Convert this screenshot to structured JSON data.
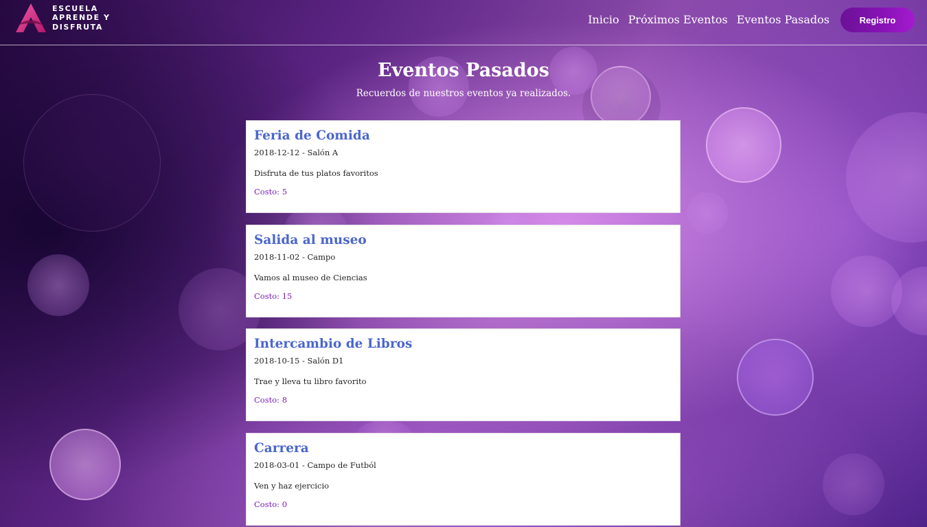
{
  "brand": {
    "logo_lines": [
      "ESCUELA",
      "APRENDE Y",
      "DISFRUTA"
    ]
  },
  "nav": {
    "items": [
      {
        "label": "Inicio"
      },
      {
        "label": "Próximos Eventos"
      },
      {
        "label": "Eventos Pasados"
      }
    ],
    "register_label": "Registro"
  },
  "page": {
    "title": "Eventos Pasados",
    "subtitle": "Recuerdos de nuestros eventos ya realizados."
  },
  "events": [
    {
      "title": "Feria de Comida",
      "date": "2018-12-12",
      "place": "Salón A",
      "meta": "2018-12-12 - Salón A",
      "description": "Disfruta de tus platos favoritos",
      "cost": "Costo: 5"
    },
    {
      "title": "Salida al museo",
      "date": "2018-11-02",
      "place": "Campo",
      "meta": "2018-11-02 - Campo",
      "description": "Vamos al museo de Ciencias",
      "cost": "Costo: 15"
    },
    {
      "title": "Intercambio de Libros",
      "date": "2018-10-15",
      "place": "Salón D1",
      "meta": "2018-10-15 - Salón D1",
      "description": "Trae y lleva tu libro favorito",
      "cost": "Costo: 8"
    },
    {
      "title": "Carrera",
      "date": "2018-03-01",
      "place": "Campo de Futból",
      "meta": "2018-03-01 - Campo de Futból",
      "description": "Ven y haz ejercicio",
      "cost": "Costo: 0"
    }
  ],
  "colors": {
    "event_title": "#4b66cc",
    "cost_text": "#7a1bbd",
    "register_button": "#8a12b8",
    "logo_mark": "#d9267f"
  }
}
